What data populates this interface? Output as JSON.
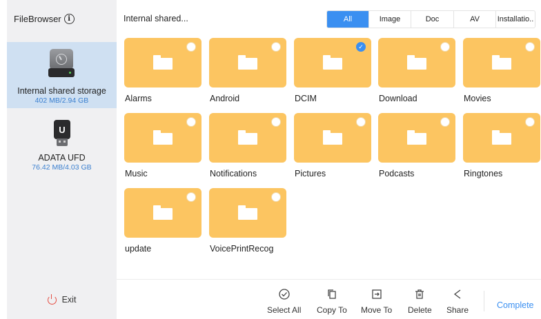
{
  "app": {
    "title": "FileBrowser"
  },
  "sidebar": {
    "storages": [
      {
        "name": "Internal shared storage",
        "size": "402 MB/2.94 GB",
        "icon": "hard-disk-icon",
        "active": true
      },
      {
        "name": "ADATA UFD",
        "size": "76.42 MB/4.03 GB",
        "icon": "usb-drive-icon",
        "active": false
      }
    ],
    "exit_label": "Exit"
  },
  "header": {
    "path": "Internal shared...",
    "filters": [
      "All",
      "Image",
      "Doc",
      "AV",
      "Installatio.."
    ],
    "active_filter": "All"
  },
  "folders": [
    {
      "name": "Alarms",
      "checked": false
    },
    {
      "name": "Android",
      "checked": false
    },
    {
      "name": "DCIM",
      "checked": true
    },
    {
      "name": "Download",
      "checked": false
    },
    {
      "name": "Movies",
      "checked": false
    },
    {
      "name": "Music",
      "checked": false
    },
    {
      "name": "Notifications",
      "checked": false
    },
    {
      "name": "Pictures",
      "checked": false
    },
    {
      "name": "Podcasts",
      "checked": false
    },
    {
      "name": "Ringtones",
      "checked": false
    },
    {
      "name": "update",
      "checked": false
    },
    {
      "name": "VoicePrintRecog",
      "checked": false
    }
  ],
  "toolbar": {
    "select_all": "Select All",
    "copy_to": "Copy To",
    "move_to": "Move To",
    "delete": "Delete",
    "share": "Share",
    "complete": "Complete"
  },
  "colors": {
    "accent": "#3a8ff1",
    "folder": "#fcc561",
    "selected_storage": "#cfe0f2",
    "exit_icon": "#e54d42"
  }
}
